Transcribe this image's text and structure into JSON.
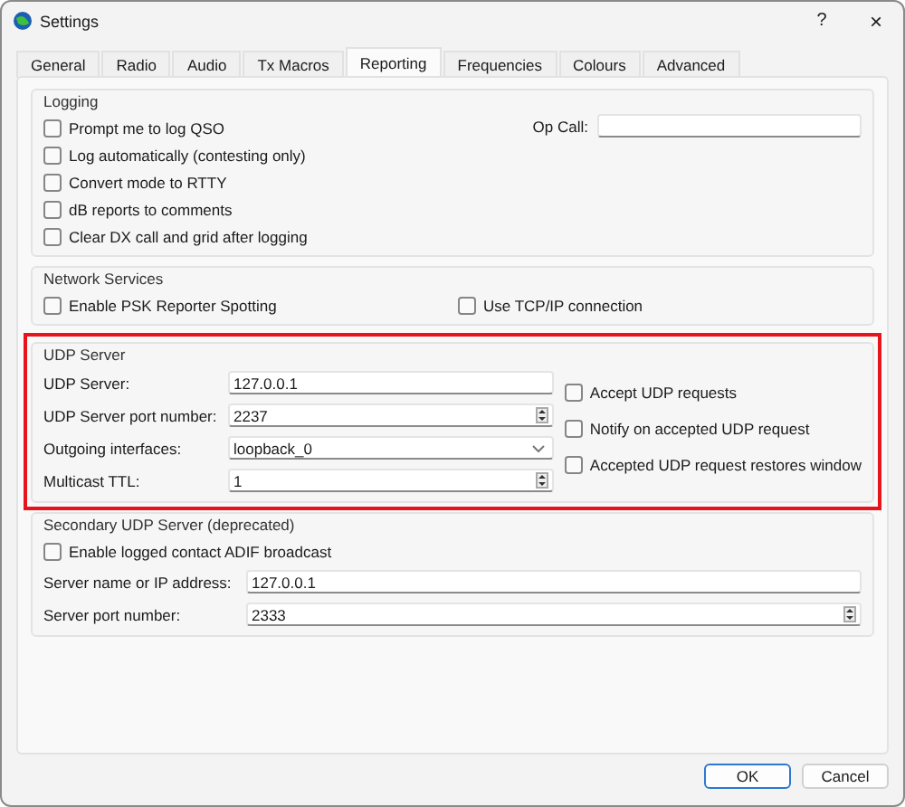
{
  "window": {
    "title": "Settings",
    "help": "?",
    "close": "×"
  },
  "tabs": [
    {
      "label": "General",
      "selected": false
    },
    {
      "label": "Radio",
      "selected": false
    },
    {
      "label": "Audio",
      "selected": false
    },
    {
      "label": "Tx Macros",
      "selected": false
    },
    {
      "label": "Reporting",
      "selected": true
    },
    {
      "label": "Frequencies",
      "selected": false
    },
    {
      "label": "Colours",
      "selected": false
    },
    {
      "label": "Advanced",
      "selected": false
    }
  ],
  "logging": {
    "title": "Logging",
    "options": [
      {
        "label": "Prompt me to log QSO",
        "checked": false
      },
      {
        "label": "Log automatically (contesting only)",
        "checked": false
      },
      {
        "label": "Convert mode to RTTY",
        "checked": false
      },
      {
        "label": "dB reports to comments",
        "checked": false
      },
      {
        "label": "Clear DX call and grid after logging",
        "checked": false
      }
    ],
    "op_call": {
      "label": "Op Call:"
    }
  },
  "network_services": {
    "title": "Network Services",
    "options": [
      {
        "label": "Enable PSK Reporter Spotting",
        "checked": false
      },
      {
        "label": "Use TCP/IP connection",
        "checked": false
      }
    ]
  },
  "udp_server": {
    "title": "UDP Server",
    "highlighted": true,
    "fields": [
      {
        "kind": "text",
        "label": "UDP Server:",
        "value": "127.0.0.1"
      },
      {
        "kind": "spin",
        "label": "UDP Server port number:",
        "value": "2237"
      },
      {
        "kind": "combo",
        "label": "Outgoing interfaces:",
        "value": "loopback_0"
      },
      {
        "kind": "spin",
        "label": "Multicast TTL:",
        "value": "1"
      }
    ],
    "options": [
      {
        "label": "Accept UDP requests",
        "checked": false
      },
      {
        "label": "Notify on accepted UDP request",
        "checked": false
      },
      {
        "label": "Accepted UDP request restores window",
        "checked": false
      }
    ]
  },
  "secondary_udp_server": {
    "title": "Secondary UDP Server (deprecated)",
    "options": [
      {
        "label": "Enable logged contact ADIF broadcast",
        "checked": false
      }
    ],
    "fields": [
      {
        "kind": "text",
        "label": "Server name or IP address:",
        "value": "127.0.0.1"
      },
      {
        "kind": "spin",
        "label": "Server port number:",
        "value": "2333"
      }
    ]
  },
  "buttons": [
    {
      "label": "OK",
      "default": true
    },
    {
      "label": "Cancel",
      "default": false
    }
  ]
}
